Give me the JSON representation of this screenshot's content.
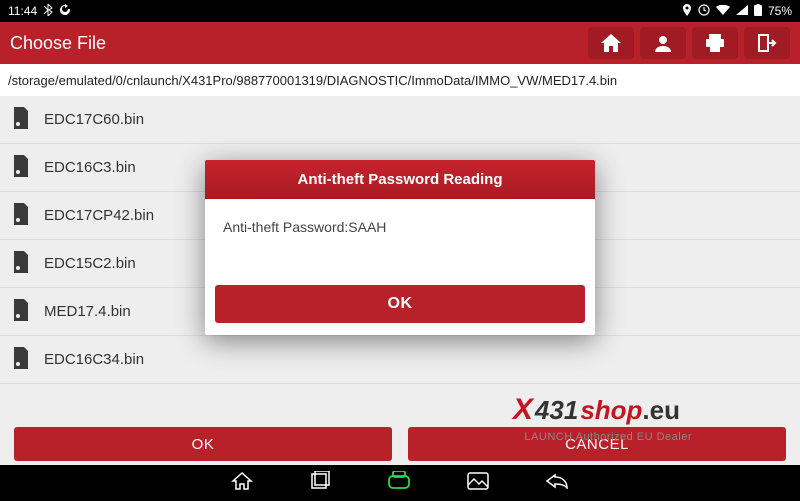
{
  "status": {
    "time": "11:44",
    "battery_pct": "75%"
  },
  "header": {
    "title": "Choose File"
  },
  "path": "/storage/emulated/0/cnlaunch/X431Pro/988770001319/DIAGNOSTIC/ImmoData/IMMO_VW/MED17.4.bin",
  "files": [
    {
      "name": "EDC17C60.bin"
    },
    {
      "name": "EDC16C3.bin"
    },
    {
      "name": "EDC17CP42.bin"
    },
    {
      "name": "EDC15C2.bin"
    },
    {
      "name": "MED17.4.bin"
    },
    {
      "name": "EDC16C34.bin"
    }
  ],
  "footer": {
    "ok": "OK",
    "cancel": "CANCEL"
  },
  "modal": {
    "title": "Anti-theft Password Reading",
    "body": "Anti-theft Password:SAAH",
    "ok": "OK"
  },
  "watermark": {
    "brand_x": "X",
    "brand_num": "431",
    "brand_shop": "shop",
    "brand_eu": ".eu",
    "sub": "LAUNCH Authorized EU Dealer"
  }
}
